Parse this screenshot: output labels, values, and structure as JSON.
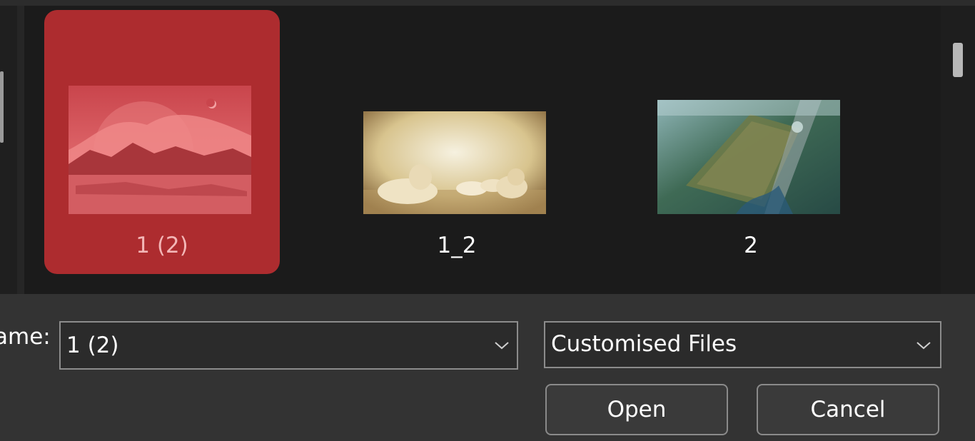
{
  "files": [
    {
      "name": "1 (2)",
      "selected": true,
      "thumbnail_icon": "pink-moonlit-landscape-thumbnail"
    },
    {
      "name": "1_2",
      "selected": false,
      "thumbnail_icon": "white-lions-thumbnail"
    },
    {
      "name": "2",
      "selected": false,
      "thumbnail_icon": "aerial-city-thumbnail"
    }
  ],
  "footer": {
    "filename_label": "ame:",
    "filename_value": "1 (2)",
    "filetype_value": "Customised Files",
    "open_label": "Open",
    "cancel_label": "Cancel"
  },
  "colors": {
    "selection": "#ad2c2f",
    "background": "#1b1b1b",
    "footer": "#333333"
  }
}
